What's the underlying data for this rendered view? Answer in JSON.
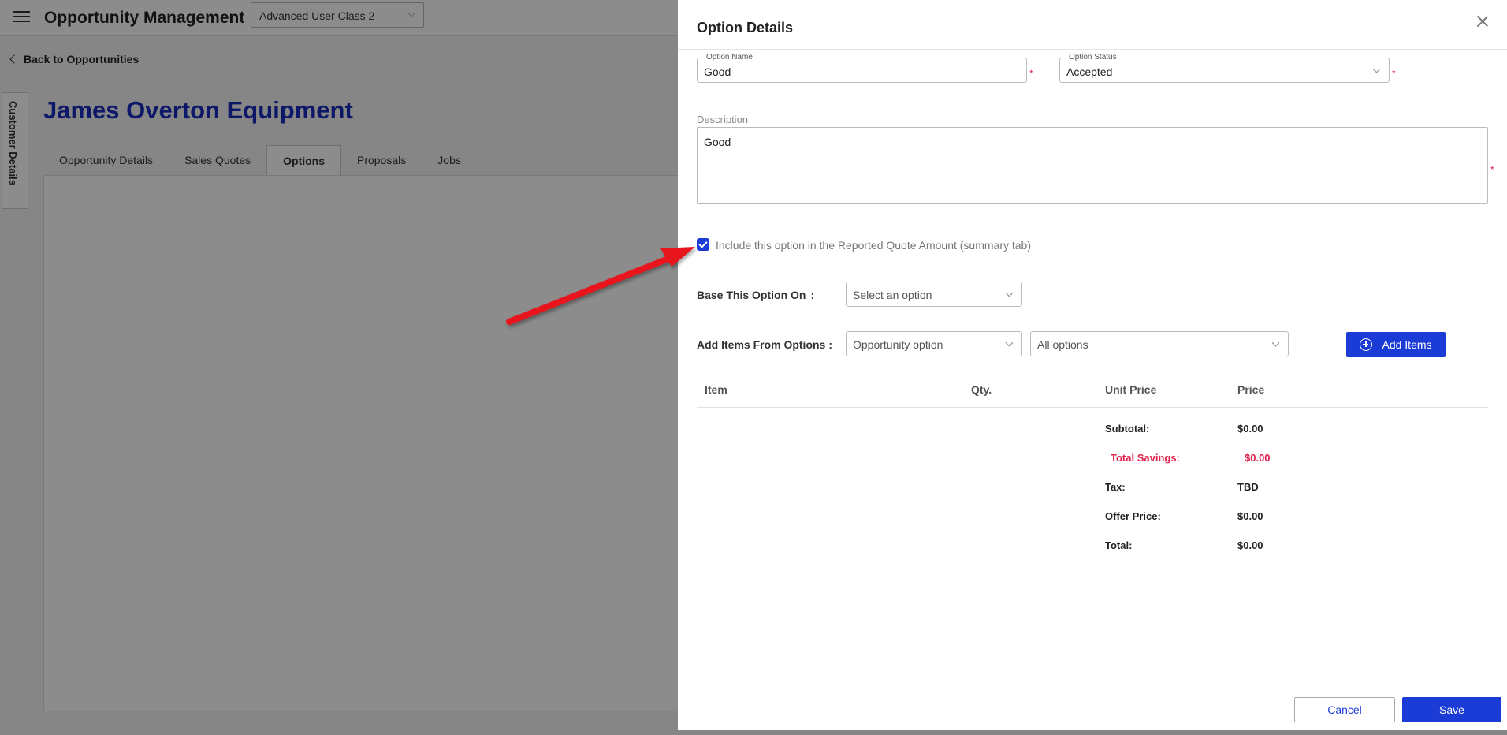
{
  "app": {
    "title": "Opportunity Management",
    "role_selected": "Advanced User Class 2",
    "back_link": "Back to Opportunities",
    "side_tab": "Customer Details",
    "page_heading": "James Overton Equipment",
    "tabs": [
      {
        "label": "Opportunity Details"
      },
      {
        "label": "Sales Quotes"
      },
      {
        "label": "Options"
      },
      {
        "label": "Proposals"
      },
      {
        "label": "Jobs"
      }
    ],
    "active_tab": "Options"
  },
  "drawer": {
    "title": "Option Details",
    "option_name": {
      "legend": "Option Name",
      "value": "Good",
      "required_mark": "*"
    },
    "option_status": {
      "legend": "Option Status",
      "value": "Accepted",
      "required_mark": "*"
    },
    "description": {
      "label": "Description",
      "value": "Good",
      "required_mark": "*"
    },
    "include_checkbox": {
      "label": "Include this option in the Reported Quote Amount (summary tab)",
      "checked": true
    },
    "base_option": {
      "label": "Base This Option On",
      "colon": ":",
      "placeholder": "Select an option"
    },
    "add_items": {
      "label": "Add Items From Options",
      "colon": ":",
      "source": "Opportunity option",
      "filter": "All options",
      "button": "Add Items"
    },
    "table": {
      "headers": [
        "Item",
        "Qty.",
        "Unit Price",
        "Price"
      ]
    },
    "summary": {
      "subtotal_label": "Subtotal:",
      "subtotal": "$0.00",
      "savings_label": "Total Savings:",
      "savings": "$0.00",
      "tax_label": "Tax:",
      "tax": "TBD",
      "offer_label": "Offer Price:",
      "offer": "$0.00",
      "total_label": "Total:",
      "total": "$0.00"
    },
    "footer": {
      "cancel": "Cancel",
      "save": "Save"
    }
  },
  "colors": {
    "accent": "#1a3bd6",
    "heading": "#1a2dbd",
    "danger": "#e0234d",
    "annotation_arrow": "#e8141a"
  }
}
